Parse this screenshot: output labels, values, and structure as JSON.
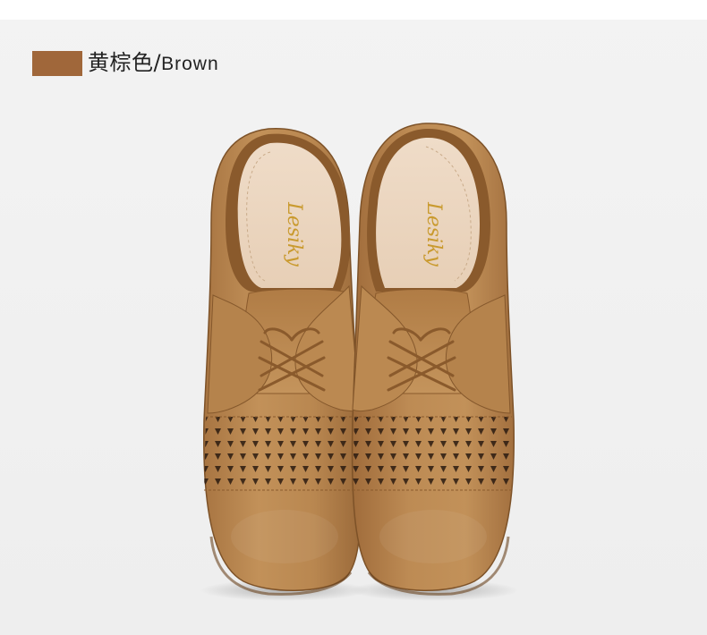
{
  "color_option": {
    "swatch_color": "#a0673a",
    "name_cn": "黄棕色",
    "separator": "/",
    "name_en": "Brown"
  },
  "photo": {
    "insole_logo": "Lesiky",
    "leather_color": "#b88952",
    "background_color": "#f0f0f0"
  }
}
